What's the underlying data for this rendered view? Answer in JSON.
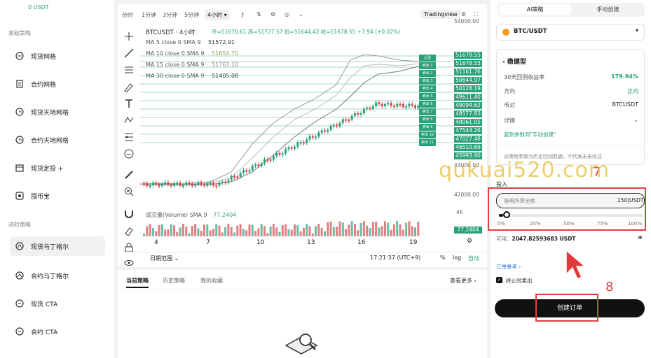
{
  "sidebar": {
    "balance": "0 USDT",
    "section_basic": "基础策略",
    "section_advanced": "进阶策略",
    "items": [
      {
        "label": "现货网格"
      },
      {
        "label": "合约网格"
      },
      {
        "label": "现货天地网格"
      },
      {
        "label": "合约天地网格"
      },
      {
        "label": "现货定投 +"
      },
      {
        "label": "囤币宝"
      },
      {
        "label": "现货马丁格尔"
      },
      {
        "label": "合约马丁格尔"
      },
      {
        "label": "现货 CTA"
      },
      {
        "label": "合约 CTA"
      }
    ]
  },
  "chart": {
    "timeframes": [
      "分时",
      "1分钟",
      "3分钟",
      "5分钟",
      "4小时"
    ],
    "active_timeframe": "4小时",
    "tradingview": "Tradingview",
    "symbol_line": "BTCUSDT · 4小时",
    "ohlc": "开=51670.61 高=51727.57 低=51644.42 收=51678.55 +7.94 (+0.02%)",
    "ma5": {
      "label": "MA 5 close 0 SMA 9",
      "value": "51572.91"
    },
    "ma10": {
      "label": "MA 10 close 0 SMA 9",
      "value": "51654.70"
    },
    "ma15": {
      "label": "MA 15 close 0 SMA 9",
      "value": "51763.10"
    },
    "ma30": {
      "label": "MA 30 close 0 SMA 9",
      "value": "51405.08"
    },
    "price_axis": [
      "54000.00",
      "52000.00",
      "50000.00",
      "48000.00",
      "46000.00",
      "44000.00",
      "42000.00"
    ],
    "price_labels": [
      "51678.55",
      "51678.55",
      "51161.76",
      "50644.97",
      "50128.19",
      "49611.40",
      "49094.62",
      "48577.83",
      "48061.05",
      "47544.26",
      "47027.48",
      "46510.69",
      "45993.90"
    ],
    "grid_tags": [
      "止盈",
      "卖出 1",
      "卖出 2",
      "卖出 3",
      "卖出 4",
      "卖出 5",
      "卖出 6",
      "卖出 7",
      "卖出 8",
      "卖出 9",
      "卖出 10",
      "卖出 11"
    ],
    "volume_label": "成交量(Volume) SMA 9",
    "volume_value": "77.2404",
    "volume_axis": "4K",
    "x_ticks": [
      "4",
      "7",
      "10",
      "13",
      "16",
      "19"
    ],
    "date_range": "日期范围",
    "time": "17:21:37 (UTC+9)",
    "pct": "%",
    "log": "log",
    "auto": "自动"
  },
  "orders": {
    "tabs": [
      "当前策略",
      "历史策略",
      "我的收藏"
    ],
    "more": "查看更多"
  },
  "right": {
    "tabs": [
      "AI策略",
      "手动创建"
    ],
    "pair": "BTC/USDT",
    "profile": "稳健型",
    "rows": [
      {
        "k": "30天回测收益率",
        "v": "179.94%"
      },
      {
        "k": "方向",
        "v": "正向"
      },
      {
        "k": "币对",
        "v": "BTCUSDT"
      },
      {
        "k": "详情",
        "v": ""
      }
    ],
    "copy_params": "复制参数到\"手动创建\"",
    "note": "该策略参数为历史回测数据，不代表未来收益",
    "invest_label": "投入",
    "amount_placeholder": "策略所需金额",
    "amount_value": "150",
    "amount_unit": "USDT",
    "slider_marks": [
      "0%",
      "25%",
      "50%",
      "75%",
      "100%"
    ],
    "slider_value": 0.03,
    "available_label": "可用：",
    "available_value": "2047.82593683 USDT",
    "order_ref": "订单参考",
    "stop_sell": "终止时卖出",
    "create_button": "创建订单"
  },
  "annotations": {
    "step7": "7",
    "step8": "8",
    "watermark": "qukuai520.com"
  }
}
